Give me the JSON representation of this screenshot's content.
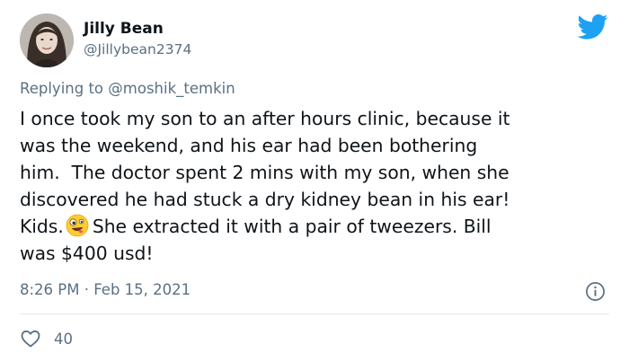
{
  "tweet": {
    "author": {
      "display_name": "Jilly Bean",
      "handle": "@Jillybean2374"
    },
    "reply": {
      "prefix": "Replying to",
      "mention": "@moshik_temkin"
    },
    "body_lines": [
      "I once took my son to an after hours clinic, because it",
      "was the weekend, and his ear had been bothering",
      "him.  The doctor spent 2 mins with my son, when she",
      "discovered he had stuck a dry kidney bean in his ear!",
      "Kids.",
      "She extracted it with a pair of tweezers. Bill",
      "was $400 usd!"
    ],
    "emoji": "zany-face-emoji",
    "timestamp": "8:26 PM · Feb 15, 2021",
    "like_count": "40"
  },
  "colors": {
    "brand_blue": "#1da1f2",
    "secondary_text": "#5b7083",
    "primary_text": "#0f1419",
    "divider": "#e1e8ed"
  },
  "icons": {
    "brand": "twitter-bird-icon",
    "info": "info-icon",
    "like": "heart-icon"
  }
}
